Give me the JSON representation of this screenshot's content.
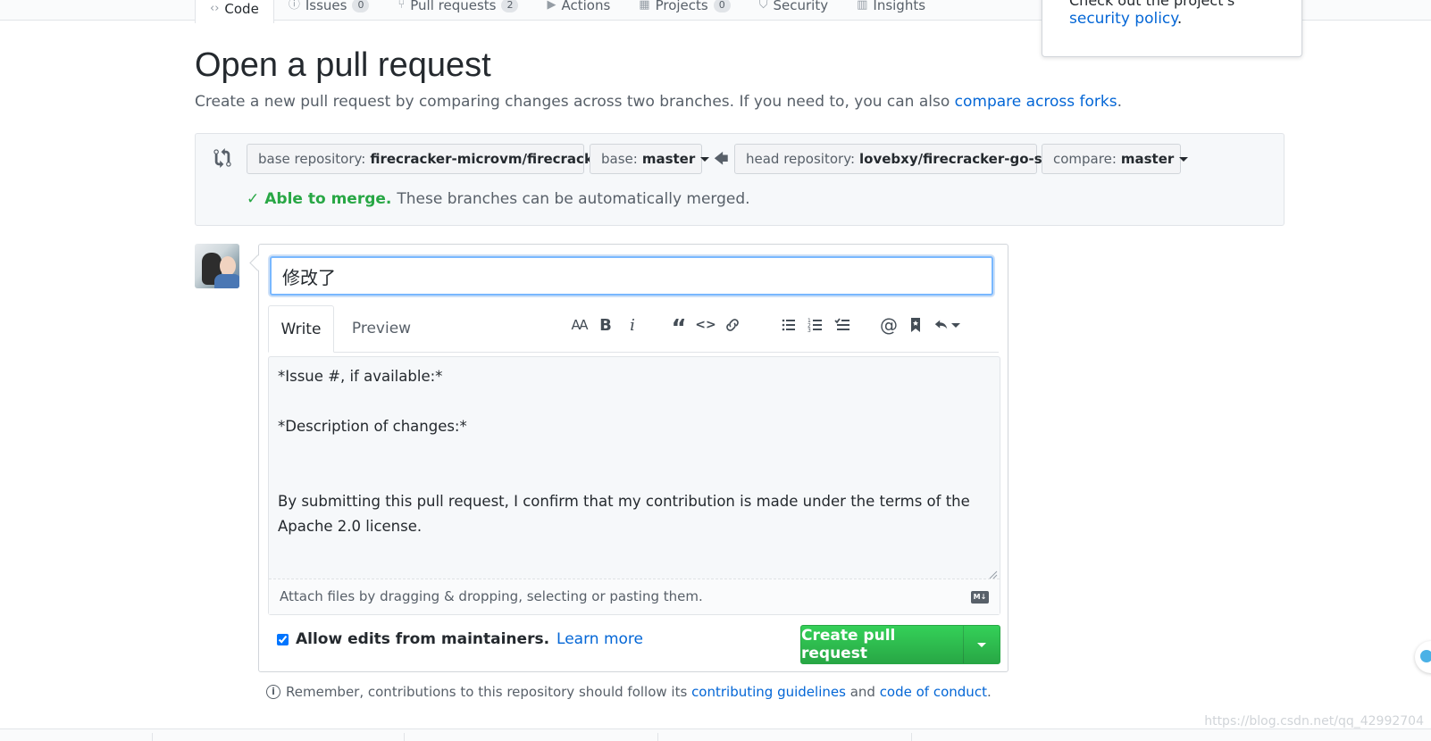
{
  "repo_nav": {
    "tabs": [
      {
        "label": "Code",
        "icon": "code-icon",
        "count": null,
        "selected": true
      },
      {
        "label": "Issues",
        "icon": "issue-icon",
        "count": "0"
      },
      {
        "label": "Pull requests",
        "icon": "pr-icon",
        "count": "2"
      },
      {
        "label": "Actions",
        "icon": "play-icon",
        "count": null
      },
      {
        "label": "Projects",
        "icon": "project-icon",
        "count": "0"
      },
      {
        "label": "Security",
        "icon": "shield-icon",
        "count": null
      },
      {
        "label": "Insights",
        "icon": "graph-icon",
        "count": null
      }
    ]
  },
  "popover": {
    "line1": "Check out the project's",
    "link": "security policy",
    "suffix": "."
  },
  "header": {
    "title": "Open a pull request",
    "desc_prefix": "Create a new pull request by comparing changes across two branches. If you need to, you can also ",
    "desc_link": "compare across forks",
    "desc_suffix": "."
  },
  "range": {
    "base_repo_label": "base repository:",
    "base_repo_value": "firecracker-microvm/firecracker...",
    "base_label": "base:",
    "base_value": "master",
    "head_repo_label": "head repository:",
    "head_repo_value": "lovebxy/firecracker-go-sdk",
    "compare_label": "compare:",
    "compare_value": "master",
    "merge_ok": "Able to merge.",
    "merge_msg": "These branches can be automatically merged."
  },
  "composer": {
    "title_value": "修改了",
    "tab_write": "Write",
    "tab_preview": "Preview",
    "toolbar": {
      "header_text": "AA",
      "bold_text": "B",
      "italic_text": "i",
      "quote_text": "“",
      "code_text": "<>",
      "mention_text": "@"
    },
    "body": "*Issue #, if available:*\n\n*Description of changes:*\n\n\nBy submitting this pull request, I confirm that my contribution is made under the terms of the Apache 2.0 license.",
    "attach_hint": "Attach files by dragging & dropping, selecting or pasting them.",
    "md_badge": "M↓",
    "allow_edits_label": "Allow edits from maintainers.",
    "learn_more": "Learn more",
    "allow_edits_checked": true,
    "create_label": "Create pull request"
  },
  "reminder": {
    "prefix": "Remember, contributions to this repository should follow its ",
    "link1": "contributing guidelines",
    "middle": " and ",
    "link2": "code of conduct",
    "suffix": "."
  },
  "watermark": "https://blog.csdn.net/qq_42992704",
  "colors": {
    "accent_link": "#0366d6",
    "success": "#28a745",
    "focus": "#79b8ff"
  }
}
